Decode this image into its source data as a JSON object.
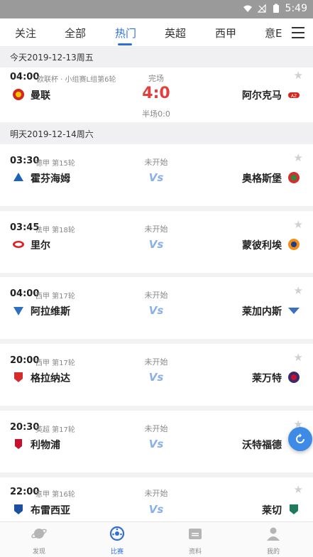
{
  "status_bar": {
    "time": "5:49"
  },
  "tabs": [
    {
      "label": "关注"
    },
    {
      "label": "全部"
    },
    {
      "label": "热门"
    },
    {
      "label": "英超"
    },
    {
      "label": "西甲"
    },
    {
      "label": "意E"
    }
  ],
  "active_tab": "热门",
  "dates": [
    {
      "label": "今天2019-12-13周五"
    },
    {
      "label": "明天2019-12-14周六"
    }
  ],
  "matches": [
    {
      "time": "04:00",
      "league": "欧联杯 · 小组赛L组第6轮",
      "status": "完场",
      "score": "4:0",
      "half": "半场0:0",
      "home": "曼联",
      "away": "阿尔克马",
      "home_color": "#d4261b",
      "away_color": "#d4261b"
    },
    {
      "time": "03:30",
      "league": "德甲 第15轮",
      "status": "未开始",
      "vs": "Vs",
      "home": "霍芬海姆",
      "away": "奥格斯堡",
      "home_color": "#1c63b7",
      "away_color": "#d32f2f"
    },
    {
      "time": "03:45",
      "league": "法甲 第18轮",
      "status": "未开始",
      "vs": "Vs",
      "home": "里尔",
      "away": "蒙彼利埃",
      "home_color": "#e21f26",
      "away_color": "#f28c1a"
    },
    {
      "time": "04:00",
      "league": "西甲 第17轮",
      "status": "未开始",
      "vs": "Vs",
      "home": "阿拉维斯",
      "away": "莱加内斯",
      "home_color": "#2e6fc0",
      "away_color": "#3a6ec8"
    },
    {
      "time": "20:00",
      "league": "西甲 第17轮",
      "status": "未开始",
      "vs": "Vs",
      "home": "格拉纳达",
      "away": "莱万特",
      "home_color": "#d42c2c",
      "away_color": "#3b2a6a"
    },
    {
      "time": "20:30",
      "league": "英超 第17轮",
      "status": "未开始",
      "vs": "Vs",
      "home": "利物浦",
      "away": "沃特福德",
      "home_color": "#c8102e",
      "away_color": "#f5d000"
    },
    {
      "time": "22:00",
      "league": "意甲 第16轮",
      "status": "未开始",
      "vs": "Vs",
      "home": "布雷西亚",
      "away": "莱切",
      "home_color": "#1d4fa0",
      "away_color": "#1f7a5c"
    }
  ],
  "bottom_nav": [
    {
      "label": "发现",
      "icon": "planet-icon"
    },
    {
      "label": "比赛",
      "icon": "soccer-ball-icon"
    },
    {
      "label": "资料",
      "icon": "folder-icon"
    },
    {
      "label": "我的",
      "icon": "person-icon"
    }
  ],
  "colors": {
    "accent": "#2f6fd8",
    "score": "#e04040",
    "float_button": "#3d8be6"
  }
}
